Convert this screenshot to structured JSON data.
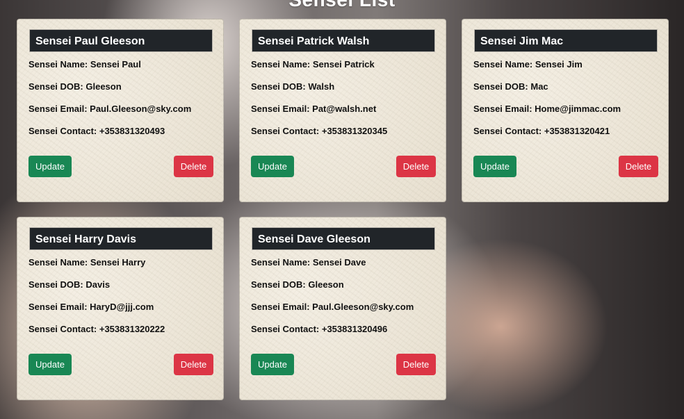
{
  "page": {
    "title": "Sensei List"
  },
  "labels": {
    "name": "Sensei Name: ",
    "dob": "Sensei DOB: ",
    "email": "Sensei Email: ",
    "contact": "Sensei Contact: ",
    "update": "Update",
    "delete": "Delete"
  },
  "senseis": [
    {
      "header": "Sensei Paul Gleeson",
      "name": "Sensei Paul",
      "dob": "Gleeson",
      "email": "Paul.Gleeson@sky.com",
      "contact": "+353831320493"
    },
    {
      "header": "Sensei Patrick Walsh",
      "name": "Sensei Patrick",
      "dob": "Walsh",
      "email": "Pat@walsh.net",
      "contact": "+353831320345"
    },
    {
      "header": "Sensei Jim Mac",
      "name": "Sensei Jim",
      "dob": "Mac",
      "email": "Home@jimmac.com",
      "contact": "+353831320421"
    },
    {
      "header": "Sensei Harry Davis",
      "name": "Sensei Harry",
      "dob": "Davis",
      "email": "HaryD@jjj.com",
      "contact": "+353831320222"
    },
    {
      "header": "Sensei Dave Gleeson",
      "name": "Sensei Dave",
      "dob": "Gleeson",
      "email": "Paul.Gleeson@sky.com",
      "contact": "+353831320496"
    }
  ],
  "colors": {
    "update": "#198754",
    "delete": "#dc3545",
    "header": "#212529"
  }
}
